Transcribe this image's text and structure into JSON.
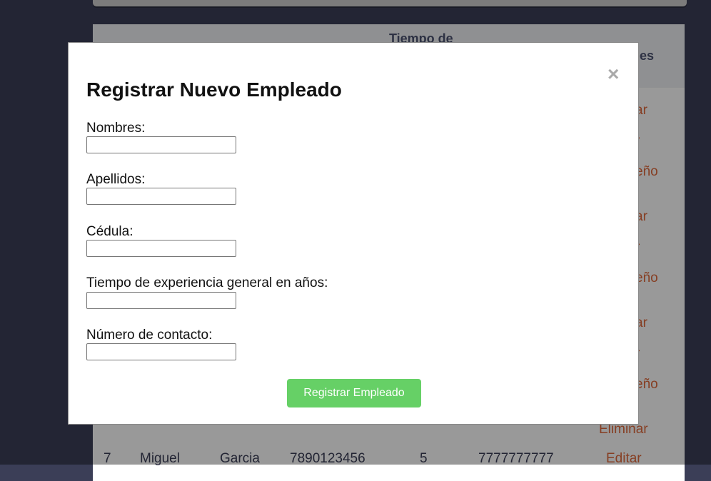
{
  "background_table": {
    "header": {
      "tiempo_partial": "Tiempo de",
      "acciones_partial": "es"
    },
    "actions": {
      "editar_partial": "r",
      "desempeno_partial": "eño",
      "eliminar_partial": "ar",
      "eliminar": "Eliminar",
      "editar": "Editar"
    },
    "visible_row": {
      "id": "7",
      "nombres": "Miguel",
      "apellidos": "Garcia",
      "cedula": "7890123456",
      "tiempo": "5",
      "contacto": "7777777777"
    }
  },
  "modal": {
    "close_glyph": "×",
    "title": "Registrar Nuevo Empleado",
    "fields": [
      {
        "label": "Nombres:",
        "value": ""
      },
      {
        "label": "Apellidos:",
        "value": ""
      },
      {
        "label": "Cédula:",
        "value": ""
      },
      {
        "label": "Tiempo de experiencia general en años:",
        "value": ""
      },
      {
        "label": "Número de contacto:",
        "value": ""
      }
    ],
    "submit_label": "Registrar Empleado"
  },
  "colors": {
    "page_background": "#3b3e57",
    "action_link": "#e06a3c",
    "submit_button": "#66d066"
  }
}
